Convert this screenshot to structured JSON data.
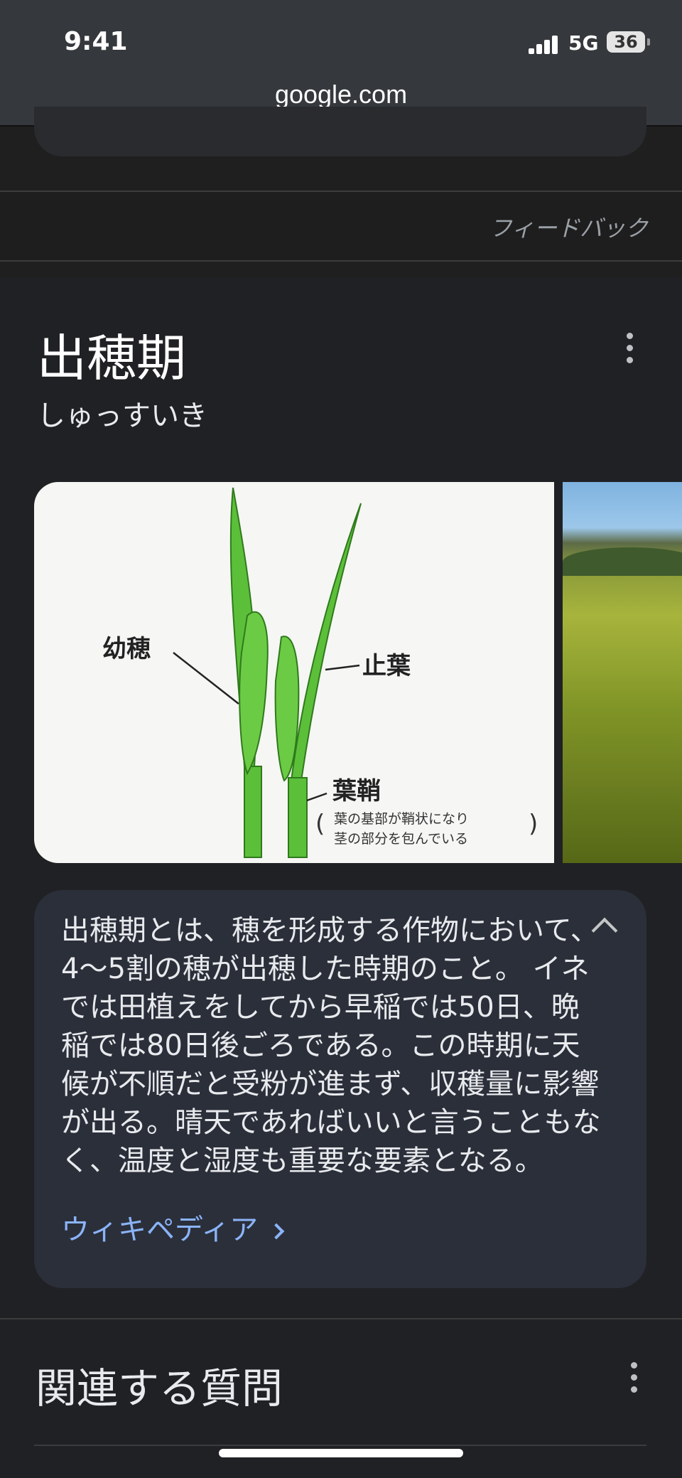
{
  "status_bar": {
    "time": "9:41",
    "network": "5G",
    "battery": "36"
  },
  "address_bar": {
    "url": "google.com"
  },
  "feedback": {
    "label": "フィードバック"
  },
  "knowledge_panel": {
    "title": "出穂期",
    "reading": "しゅっすいき",
    "image_labels": {
      "young_panicle": "幼穂",
      "flag_leaf": "止葉",
      "leaf_sheath": "葉鞘",
      "sheath_note_line1": "葉の基部が鞘状になり",
      "sheath_note_line2": "茎の部分を包んでいる"
    },
    "description": "出穂期とは、穂を形成する作物において、4〜5割の穂が出穂した時期のこと。 イネでは田植えをしてから早稲では50日、晩稲では80日後ごろである。この時期に天候が不順だと受粉が進まず、収穫量に影響が出る。晴天であればいいと言うこともなく、温度と湿度も重要な要素となる。",
    "source_link": "ウィキペディア"
  },
  "related": {
    "title": "関連する質問"
  },
  "colors": {
    "link": "#8ab4f8",
    "leaf_green": "#5cbf3a",
    "card_bg": "#2b2f3a"
  }
}
